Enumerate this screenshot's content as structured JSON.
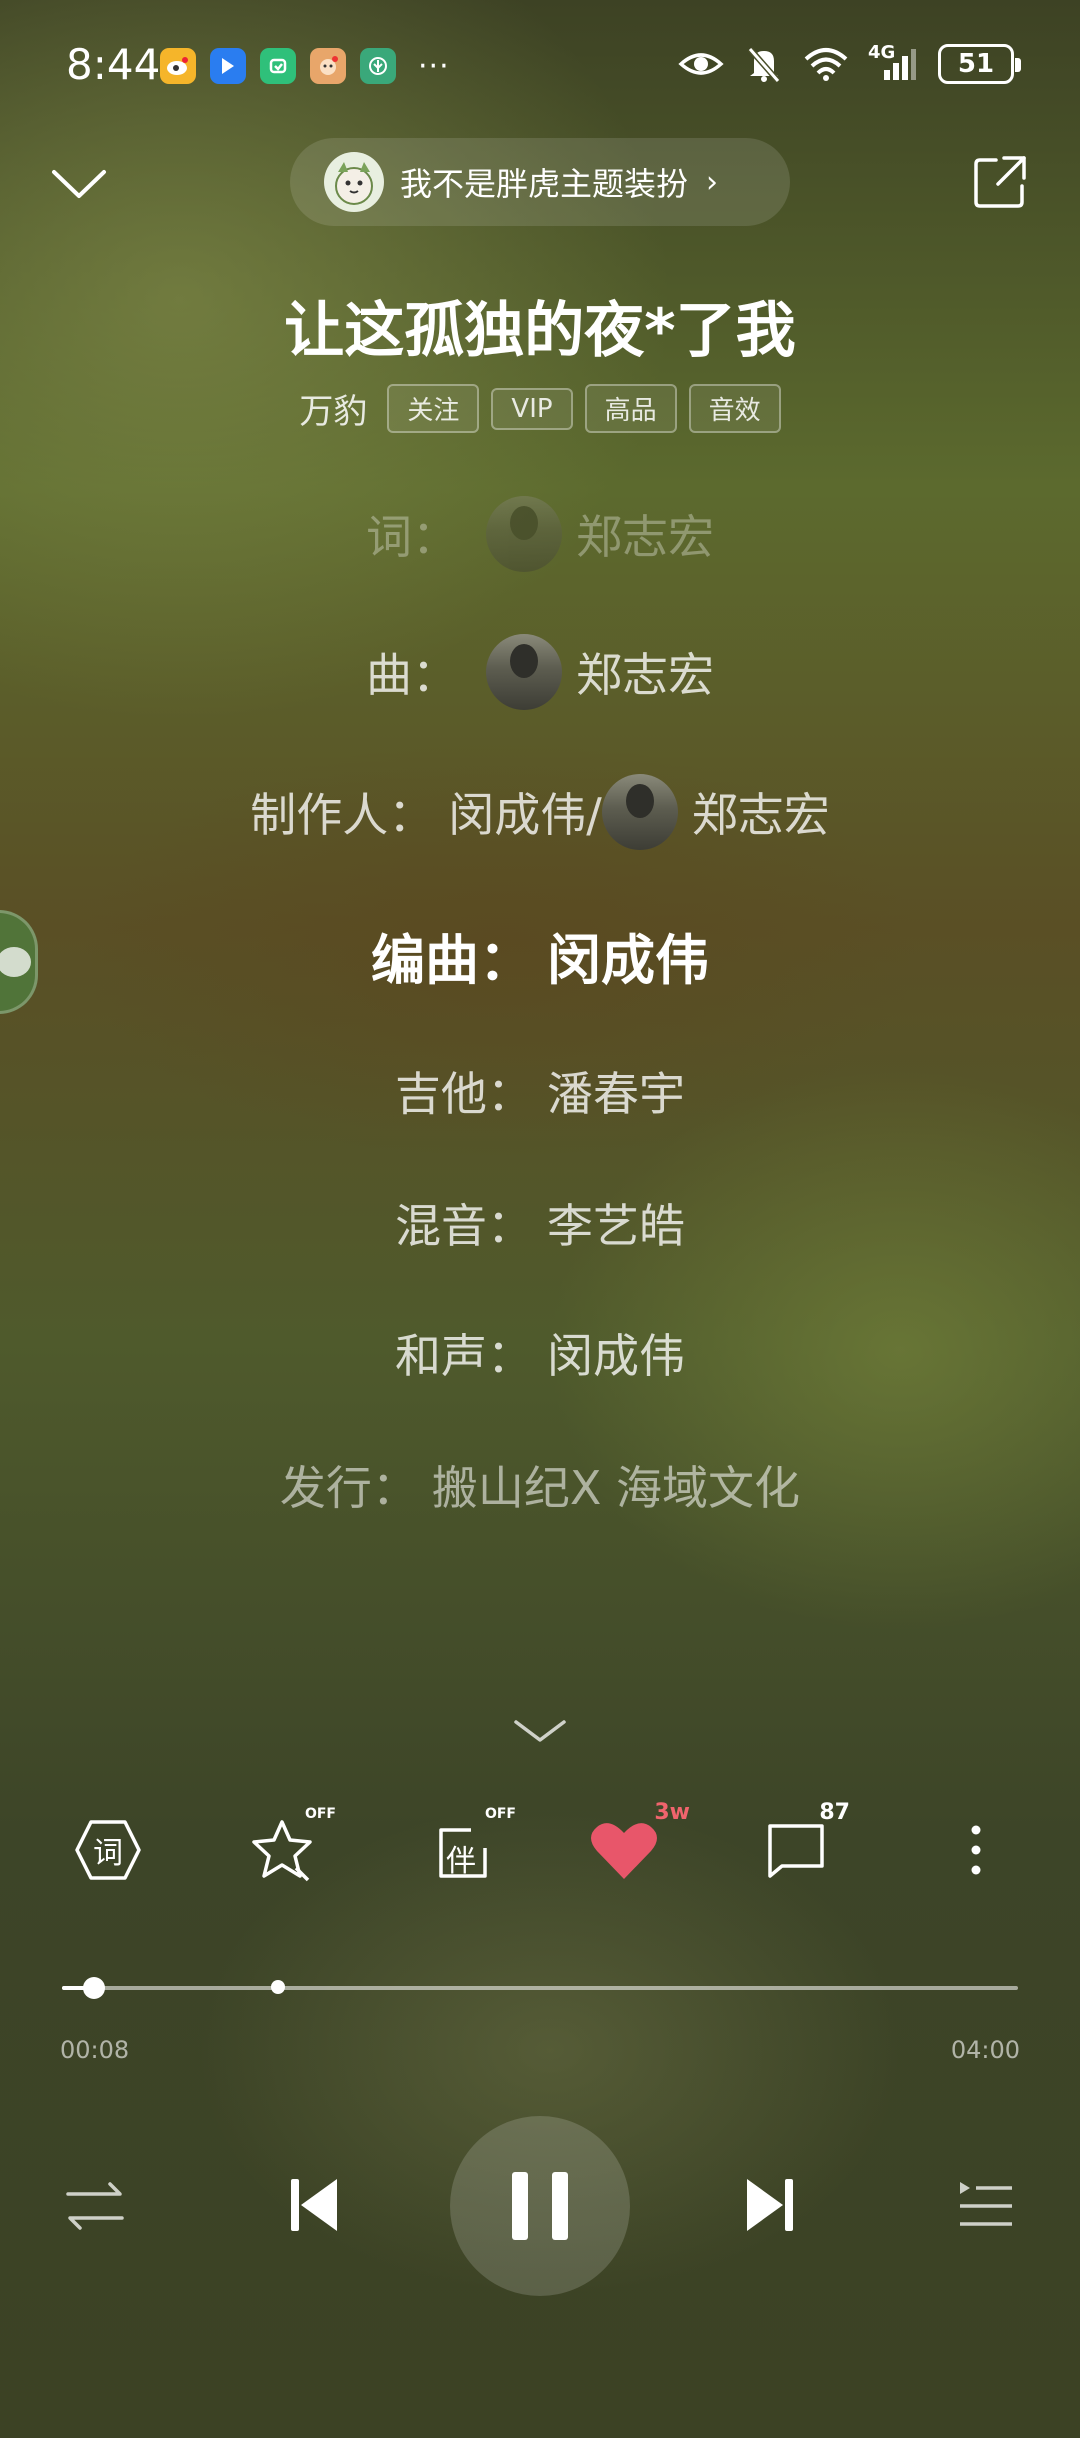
{
  "status_bar": {
    "time": "8:44",
    "network": "4G",
    "battery": "51",
    "more": "···",
    "app_icons": [
      {
        "name": "weibo-app-icon",
        "color": "#f5b52a"
      },
      {
        "name": "feishu-app-icon",
        "color": "#2a7df0"
      },
      {
        "name": "green-app-icon",
        "color": "#2fc07a"
      },
      {
        "name": "cartoon-app-icon",
        "color": "#e8a66a"
      },
      {
        "name": "leaf-app-icon",
        "color": "#3aa87a"
      }
    ]
  },
  "header": {
    "theme_label": "我不是胖虎主题装扮",
    "theme_chevron": "›"
  },
  "song": {
    "title": "让这孤独的夜*了我",
    "artist": "万豹",
    "tags": [
      "关注",
      "VIP",
      "高品",
      "音效"
    ]
  },
  "credits": [
    {
      "label": "词：",
      "value": "郑志宏",
      "avatar": true
    },
    {
      "label": "曲：",
      "value": "郑志宏",
      "avatar": true
    },
    {
      "label": "制作人：",
      "value_prefix": "闵成伟/",
      "value": "郑志宏",
      "avatar": true
    },
    {
      "label": "编曲：",
      "value": "闵成伟"
    },
    {
      "label": "吉他：",
      "value": "潘春宇"
    },
    {
      "label": "混音：",
      "value": "李艺皓"
    },
    {
      "label": "和声：",
      "value": "闵成伟"
    },
    {
      "label": "发行：",
      "value": "搬山纪X 海域文化"
    }
  ],
  "actions": {
    "lyrics_icon_text": "词",
    "accompany_icon_text": "伴",
    "off_badge": "OFF",
    "like_count": "3w",
    "comment_count": "87"
  },
  "progress": {
    "elapsed": "00:08",
    "total": "04:00",
    "elapsed_fraction": 0.033,
    "marker_fraction": 0.226
  },
  "colors": {
    "like": "#e8566a",
    "accent_text": "#ffffff"
  }
}
